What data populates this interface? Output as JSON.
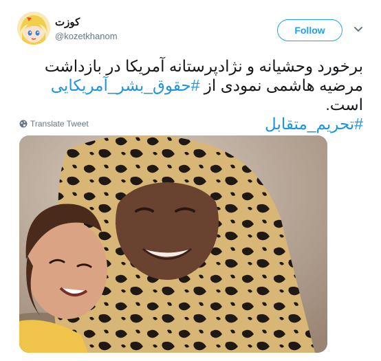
{
  "user": {
    "display_name": "کوزت",
    "handle": "@kozetkhanom",
    "avatar_icon": "anime-avatar-icon"
  },
  "actions": {
    "follow_label": "Follow",
    "more_icon": "chevron-down-icon"
  },
  "tweet": {
    "text_part1": "برخورد وحشیانه و نژادپرستانه آمریکا در بازداشت مرضیه هاشمی نمودی از ",
    "hashtag1": "#حقوق_بشر_آمریکایی",
    "text_part2": " است.",
    "hashtag2": "#تحریم_متقابل"
  },
  "translate": {
    "label": "Translate Tweet",
    "icon": "globe-icon"
  },
  "colors": {
    "accent": "#1da1f2",
    "hashtag": "#1b95e0",
    "secondary_text": "#657786"
  }
}
